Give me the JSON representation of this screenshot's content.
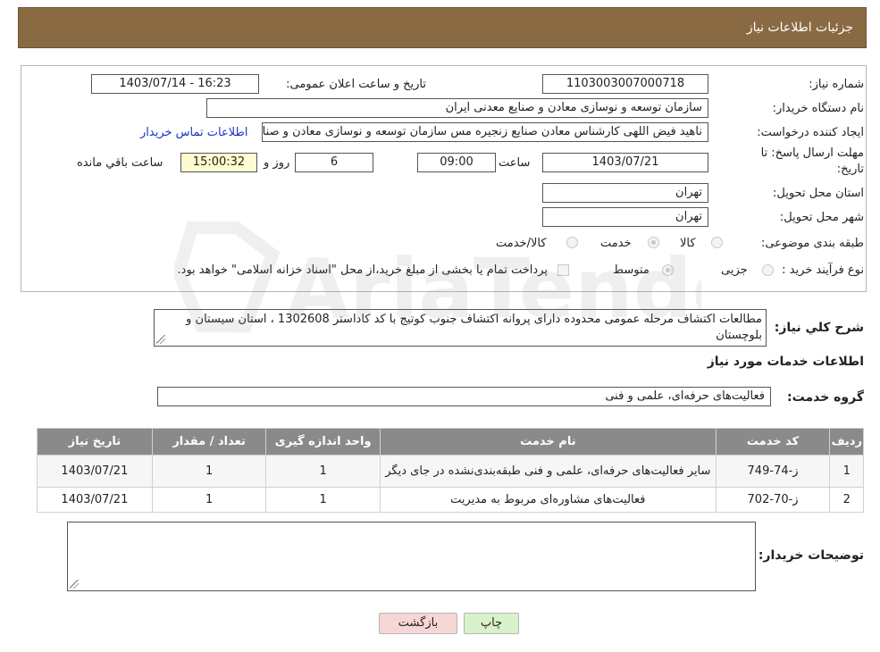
{
  "header": {
    "title": "جزئیات اطلاعات نیاز"
  },
  "form": {
    "need_number_label": "شماره نیاز:",
    "need_number": "1103003007000718",
    "announce_label": "تاریخ و ساعت اعلان عمومی:",
    "announce_value": "1403/07/14 - 16:23",
    "buyer_org_label": "نام دستگاه خریدار:",
    "buyer_org": "سازمان توسعه و نوسازی معادن و صنایع معدنی ایران",
    "creator_label": "ایجاد کننده درخواست:",
    "creator": "ناهید فیض اللهی کارشناس معادن صنایع زنجیره مس سازمان توسعه و نوسازی معادن و صنایع معدنی ایران",
    "contact_link": "اطلاعات تماس خریدار",
    "deadline_label_1": "مهلت ارسال پاسخ: تا",
    "deadline_label_2": "تاریخ:",
    "deadline_date": "1403/07/21",
    "time_label": "ساعت",
    "deadline_time": "09:00",
    "days_value": "6",
    "days_label": "روز و",
    "remaining_time": "15:00:32",
    "remaining_label": "ساعت باقي مانده",
    "province_label": "استان محل تحویل:",
    "province": "تهران",
    "city_label": "شهر محل تحویل:",
    "city": "تهران",
    "category_label": "طبقه بندی موضوعی:",
    "category_options": [
      "کالا",
      "خدمت",
      "کالا/خدمت"
    ],
    "process_label": "نوع فرآیند خرید :",
    "process_options": [
      "جزیی",
      "متوسط"
    ],
    "payment_note": "پرداخت تمام یا بخشی از مبلغ خرید،از محل \"اسناد خزانه اسلامی\" خواهد بود."
  },
  "description": {
    "label": "شرح کلي نياز:",
    "text": "مطالعات اکتشاف  مرحله عمومی  محدوده دارای پروانه اکتشاف جنوب کوتیج  با کد کاداستر 1302608 ، استان سیستان و بلوچستان"
  },
  "services": {
    "section_title": "اطلاعات خدمات مورد نیاز",
    "group_label": "گروه خدمت:",
    "group_value": "فعالیت‌های حرفه‌ای، علمی و فنی",
    "columns": [
      "ردیف",
      "کد خدمت",
      "نام خدمت",
      "واحد اندازه گیری",
      "تعداد / مقدار",
      "تاریخ نیاز"
    ],
    "rows": [
      [
        "1",
        "ز-74-749",
        "سایر فعالیت‌های حرفه‌ای، علمی و فنی طبقه‌بندی‌نشده در جای دیگر",
        "1",
        "1",
        "1403/07/21"
      ],
      [
        "2",
        "ز-70-702",
        "فعالیت‌های مشاوره‌ای مربوط به مدیریت",
        "1",
        "1",
        "1403/07/21"
      ]
    ]
  },
  "notes": {
    "label": "توضیحات خریدار:"
  },
  "buttons": {
    "print": "چاپ",
    "back": "بازگشت"
  },
  "watermark": {
    "text": "AriaTender.neT"
  },
  "colors": {
    "header_bg": "#8a6a43",
    "table_header_bg": "#8a8a8a",
    "link": "#1a33c9",
    "yellow_field": "#fdfbd0"
  }
}
